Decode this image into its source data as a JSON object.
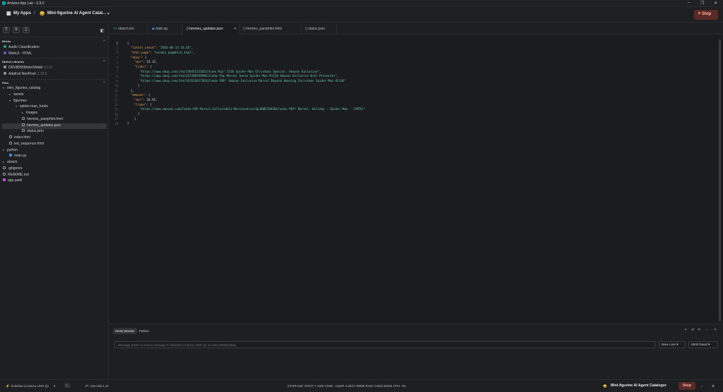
{
  "window": {
    "title": "Arduino App Lab - 0.8.0",
    "minimize": "–",
    "maximize": "❐",
    "close": "✕"
  },
  "header": {
    "apps_label": "My Apps",
    "separator": "/",
    "app_emoji": "😀",
    "app_name": "Mini-figurine AI Agent Catal...",
    "chevron": "▾",
    "stop_label": "Stop"
  },
  "sidebar": {
    "toolbar": [
      "⎘",
      "⧉",
      "⎙"
    ],
    "collapse": "◧",
    "bricks_title": "Bricks",
    "bricks": [
      {
        "label": "Audio Classification",
        "color": "#1fa87a"
      },
      {
        "label": "WebUI - HTML",
        "color": "#7b4fd6"
      }
    ],
    "libs_title": "Sketch Libraries",
    "libraries": [
      {
        "label": "DRV8835MotorShield",
        "version": "2.1.0"
      },
      {
        "label": "Adafruit NeoPixel",
        "version": "1.15.5"
      }
    ],
    "files_title": "Files",
    "files": [
      {
        "label": "mini_figurine_catalog",
        "arrow": "▾",
        "icon": ""
      },
      {
        "label": "assets",
        "arrow": "▸",
        "icon": ""
      },
      {
        "label": "figurines",
        "arrow": "▾",
        "icon": ""
      },
      {
        "label": "spider-man_funko",
        "arrow": "▾",
        "icon": ""
      },
      {
        "label": "images",
        "arrow": "▸",
        "icon": ""
      },
      {
        "label": "hermes_pamphlet.html",
        "arrow": "",
        "icon": "file"
      },
      {
        "label": "hermes_updates.json",
        "arrow": "",
        "icon": "file"
      },
      {
        "label": "status.json",
        "arrow": "",
        "icon": "file"
      },
      {
        "label": "index.html",
        "arrow": "",
        "icon": "file"
      },
      {
        "label": "led_sequence.html",
        "arrow": "",
        "icon": "file"
      },
      {
        "label": "python",
        "arrow": "▾",
        "icon": ""
      },
      {
        "label": "main.py",
        "arrow": "",
        "icon": "py"
      },
      {
        "label": "sketch",
        "arrow": "▸",
        "icon": ""
      },
      {
        "label": ".gitignore",
        "arrow": "",
        "icon": "file"
      },
      {
        "label": "README.md",
        "arrow": "",
        "icon": "file"
      },
      {
        "label": "app.yaml",
        "arrow": "",
        "icon": "yaml"
      }
    ]
  },
  "tabs": [
    {
      "label": "sketch.ino",
      "icon": "<>"
    },
    {
      "label": "main.py",
      "icon": "◆"
    },
    {
      "label": "hermes_updates.json",
      "icon": "▯",
      "close": "✕"
    },
    {
      "label": "hermes_pamphlet.html",
      "icon": "▯"
    },
    {
      "label": "status.json",
      "icon": "▯"
    }
  ],
  "editor": {
    "lines": [
      {
        "n": "1",
        "k": "",
        "p": "{",
        "v": ""
      },
      {
        "n": "2",
        "k": "\"latest_check\"",
        "p": ": ",
        "v": "\"2026-06-14 14:36\","
      },
      {
        "n": "3",
        "k": "\"html_page\"",
        "p": ": ",
        "v": "\"hermes_pamphlet.html\","
      },
      {
        "n": "4",
        "k": "\"ebay\"",
        "p": ": {",
        "v": ""
      },
      {
        "n": "5",
        "k": "\"avr\"",
        "p": ": 24.32,",
        "v": ""
      },
      {
        "n": "6",
        "k": "\"links\"",
        "p": ": [",
        "v": ""
      },
      {
        "n": "7",
        "k": "",
        "p": "",
        "v": "\"https://www.ebay.com/itm/256415221023|Funk Pop! 1136 Spider-Man Christmas Special. Amazon Exclusive\","
      },
      {
        "n": "8",
        "k": "",
        "p": "",
        "v": "\"https://www.ebay.com/itm/267289549986|Funko Pop Marvel Santa Spider-Man #1136 Amazon Exclusive With Protector\","
      },
      {
        "n": "9",
        "k": "",
        "p": "",
        "v": "\"https://www.ebay.com/itm/167633917303|Funko POP! Amazon Exclusive Marvel Beyond Amazing Christmas Spider-Man #1136\""
      },
      {
        "n": "10",
        "k": "",
        "p": "]",
        "v": ""
      },
      {
        "n": "11",
        "k": "",
        "p": "},",
        "v": ""
      },
      {
        "n": "12",
        "k": "\"amazon\"",
        "p": ": {",
        "v": ""
      },
      {
        "n": "13",
        "k": "\"avr\"",
        "p": ": 18.95,",
        "v": ""
      },
      {
        "n": "14",
        "k": "\"links\"",
        "p": ": [",
        "v": ""
      },
      {
        "n": "15",
        "k": "",
        "p": "",
        "v": "\"https://www.amazon.com/Funko-POP-Marvel-Collectable-Merchandise/dp/B0B7366SN|Funko POP! Marvel: Holiday - Spider-Man - (SMTR)\""
      },
      {
        "n": "16",
        "k": "",
        "p": "]",
        "v": ""
      },
      {
        "n": "17",
        "k": "",
        "p": "}",
        "v": ""
      },
      {
        "n": "18",
        "k": "",
        "p": "}",
        "v": ""
      }
    ]
  },
  "panel": {
    "tabs": [
      "Serial Monitor",
      "Python"
    ],
    "icons": [
      "▾",
      "⚙",
      "⇋",
      "–",
      "✕"
    ],
    "message_placeholder": "Message (Enter to send a message to 'kuituhan (Arduino UNO Q)' on usbc2283622383)",
    "line_ending": "New Line",
    "baud": "9600 baud",
    "dd_arrow": "▾"
  },
  "status": {
    "device": "kuituhan (Arduino UNO Q)",
    "device_chevron": "▾",
    "terminal_icon": ">_",
    "ip": "IP: 192.168.1.21",
    "storage": "STORAGE: ROOT 7.33/9.72GB - USER 4.29/17.09GB   RAM: 0.85/3.58GB   CPU: 4%",
    "app_emoji": "😀",
    "app_name": "Mini-figurine AI Agent Cataloger",
    "stop_label": "Stop",
    "bell_icon": "♪",
    "settings_icon": "⚙"
  },
  "colors": {
    "accent": "#0ca1a6",
    "stop_bg": "#5a2a26",
    "stop_text": "#ffb3a6",
    "json_key": "#e8a85a",
    "json_string": "#67c6b0"
  }
}
